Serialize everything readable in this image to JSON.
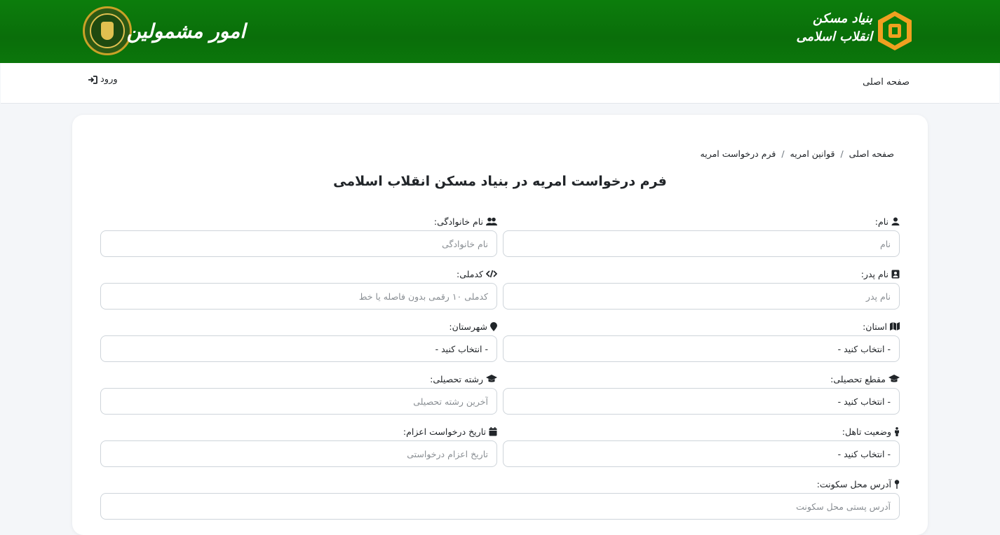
{
  "header": {
    "title": "امور مشمولین",
    "brand_text": "بنیاد مسکن انقلاب اسلامی",
    "emblem_icon": "police-emblem-icon",
    "brand_logo_icon": "housing-foundation-logo-icon",
    "colors": {
      "header_green": "#0a7a0a",
      "logo_orange": "#f0a020"
    }
  },
  "nav": {
    "home_label": "صفحه اصلی",
    "login_label": "ورود",
    "login_icon": "sign-in-icon"
  },
  "breadcrumb": {
    "items": [
      "صفحه اصلی",
      "قوانین امریه",
      "فرم درخواست امریه"
    ],
    "separator": "/"
  },
  "form": {
    "title": "فرم درخواست امریه در بنیاد مسکن انقلاب اسلامی",
    "fields": {
      "first_name": {
        "label": "نام:",
        "placeholder": "نام",
        "icon": "user-icon"
      },
      "last_name": {
        "label": "نام خانوادگی:",
        "placeholder": "نام خانوادگی",
        "icon": "users-icon"
      },
      "father_name": {
        "label": "نام پدر:",
        "placeholder": "نام پدر",
        "icon": "id-card-icon"
      },
      "national_code": {
        "label": "کدملی:",
        "placeholder": "کدملی ۱۰ رقمی بدون فاصله یا خط",
        "icon": "code-icon"
      },
      "province": {
        "label": "استان:",
        "value": "- انتخاب کنید -",
        "icon": "map-icon"
      },
      "city": {
        "label": "شهرستان:",
        "value": "- انتخاب کنید -",
        "icon": "map-marker-icon"
      },
      "education_level": {
        "label": "مقطع تحصیلی:",
        "value": "- انتخاب کنید -",
        "icon": "graduation-cap-icon"
      },
      "education_field": {
        "label": "رشته تحصیلی:",
        "placeholder": "آخرین رشته تحصیلی",
        "icon": "graduation-cap-icon"
      },
      "marital_status": {
        "label": "وضعیت تاهل:",
        "value": "- انتخاب کنید -",
        "icon": "person-icon"
      },
      "dispatch_date": {
        "label": "تاریخ درخواست اعزام:",
        "placeholder": "تاریخ اعزام درخواستی",
        "icon": "calendar-icon"
      },
      "address": {
        "label": "آدرس محل سکونت:",
        "placeholder": "آدرس پستی محل سکونت",
        "icon": "map-pin-icon"
      }
    }
  }
}
